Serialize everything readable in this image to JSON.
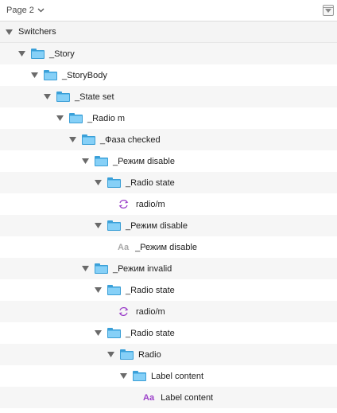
{
  "header": {
    "page_label": "Page 2"
  },
  "section": {
    "title": "Switchers"
  },
  "layers": [
    {
      "type": "group",
      "label": "_Story",
      "depth": 1
    },
    {
      "type": "group",
      "label": "_StoryBody",
      "depth": 2
    },
    {
      "type": "group",
      "label": "_State set",
      "depth": 3
    },
    {
      "type": "group",
      "label": "_Radio m",
      "depth": 4
    },
    {
      "type": "group",
      "label": "_Фаза checked",
      "depth": 5
    },
    {
      "type": "group",
      "label": "_Режим disable",
      "depth": 6
    },
    {
      "type": "group",
      "label": "_Radio state",
      "depth": 7
    },
    {
      "type": "symbol",
      "label": "radio/m",
      "depth": 8
    },
    {
      "type": "group",
      "label": "_Режим disable",
      "depth": 7
    },
    {
      "type": "text",
      "label": "_Режим disable",
      "depth": 8,
      "icon_text": "Aa",
      "icon_color": "#a8a8a8"
    },
    {
      "type": "group",
      "label": "_Режим invalid",
      "depth": 6
    },
    {
      "type": "group",
      "label": "_Radio state",
      "depth": 7
    },
    {
      "type": "symbol",
      "label": "radio/m",
      "depth": 8
    },
    {
      "type": "group",
      "label": "_Radio state",
      "depth": 7
    },
    {
      "type": "group",
      "label": "Radio",
      "depth": 8
    },
    {
      "type": "group",
      "label": "Label content",
      "depth": 9
    },
    {
      "type": "text",
      "label": "Label content",
      "depth": 10,
      "icon_text": "Aa",
      "icon_color": "#9b3fc9"
    }
  ],
  "colors": {
    "folder": "#5cb9ec",
    "symbol": "#9b3fc9",
    "row_alt": "#f6f6f6"
  }
}
